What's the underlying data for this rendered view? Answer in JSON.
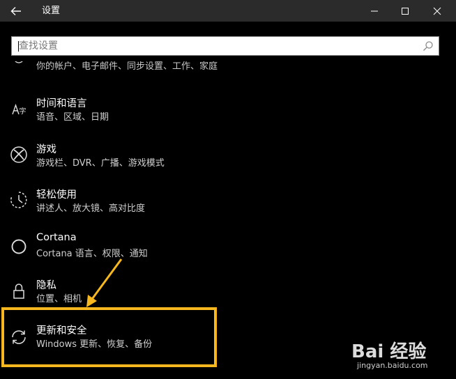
{
  "window": {
    "title": "设置"
  },
  "search": {
    "placeholder": "查找设置"
  },
  "cut_item": {
    "desc": "你的帐户、电子邮件、同步设置、工作、家庭"
  },
  "items": [
    {
      "name": "时间和语言",
      "desc": "语音、区域、日期",
      "icon": "time-language-icon"
    },
    {
      "name": "游戏",
      "desc": "游戏栏、DVR、广播、游戏模式",
      "icon": "xbox-icon"
    },
    {
      "name": "轻松使用",
      "desc": "讲述人、放大镜、高对比度",
      "icon": "ease-of-access-icon"
    },
    {
      "name": "Cortana",
      "desc": "Cortana 语言、权限、通知",
      "icon": "cortana-icon"
    },
    {
      "name": "隐私",
      "desc": "位置、相机",
      "icon": "lock-icon"
    },
    {
      "name": "更新和安全",
      "desc": "Windows 更新、恢复、备份",
      "icon": "update-icon"
    }
  ],
  "watermark": {
    "logo": "Bai 经验",
    "sub": "jingyan.baidu.com"
  },
  "colors": {
    "titlebar": "#2b2b2b",
    "background": "#000000",
    "highlight": "#f6b81e"
  }
}
